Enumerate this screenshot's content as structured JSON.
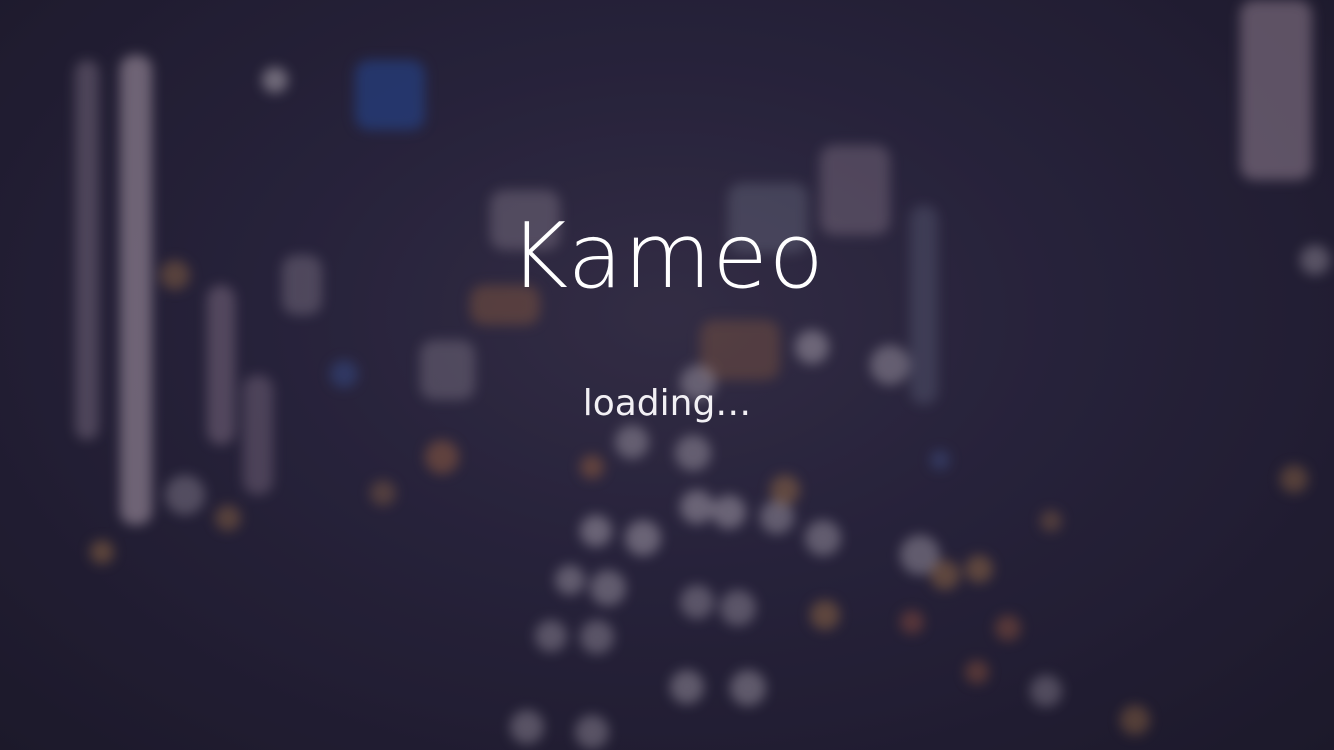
{
  "app": {
    "title": "Kameo",
    "status": "loading…"
  },
  "colors": {
    "background": "#211d33",
    "text": "#ffffff",
    "bokeh_warm": "#d88a52",
    "bokeh_white": "#cfc7d3",
    "bokeh_blue": "#2e66c0"
  },
  "background": {
    "description_icon": "blurred-city-night-background"
  }
}
